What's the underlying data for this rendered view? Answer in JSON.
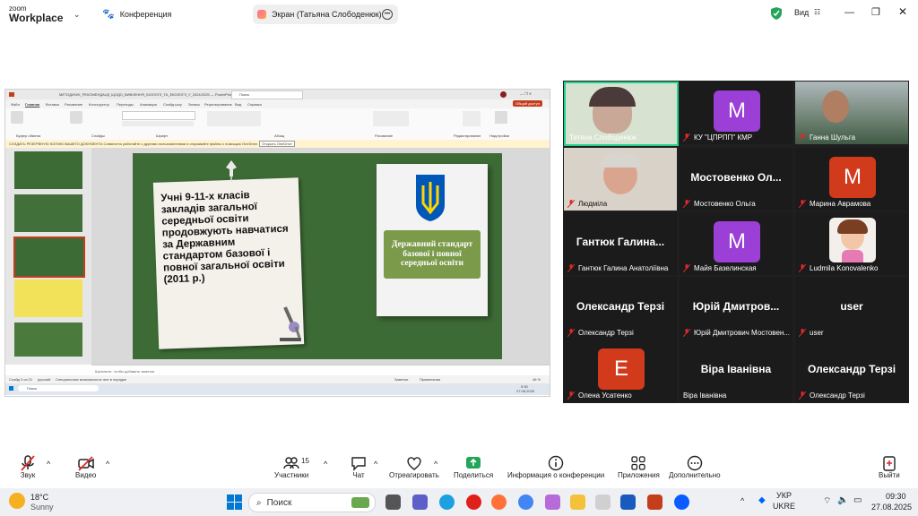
{
  "zoom": {
    "logo_line1": "zoom",
    "logo_line2": "Workplace",
    "conference_label": "Конференция",
    "screen_share_label": "Экран (Татьяна Слободенюк)",
    "view_label": "Вид"
  },
  "ppt": {
    "title": "МЕТОДИЧНІ_РЕКОМЕНДАЦІЇ_ЩОДО_ВИВЧЕННЯ_БІОЛОГІЇ_ТА_ЕКОЛОГІЇ_У_2024/2025 — PowerPoint",
    "search": "Поиск",
    "menu": [
      "Файл",
      "Главная",
      "Вставка",
      "Рисование",
      "Конструктор",
      "Переходы",
      "Анимация",
      "Слайд-шоу",
      "Запись",
      "Рецензирование",
      "Вид",
      "Справка"
    ],
    "share_button": "Общий доступ",
    "ribbon_groups": [
      "Буфер обмена",
      "Слайды",
      "Шрифт",
      "Абзац",
      "Рисование",
      "Редактирование",
      "Надстройки"
    ],
    "notif": "СОЗДАТЬ РЕЗЕРВНУЮ КОПИЮ ВАШЕГО ДОКУМЕНТА   Совместно работайте с другими пользователями и открывайте файлы с помощью OneDrive.",
    "notif_button": "Открыть OneDrive",
    "notes_placeholder": "Щелкните, чтобы добавить заметки",
    "status_left": "Слайд 3 из 21",
    "status_lang": "русский",
    "status_a11y": "Специальные возможности: все в порядке",
    "status_notes": "Заметки",
    "status_comments": "Примечания",
    "status_zoom": "46 %",
    "taskbar_search": "Поиск",
    "clock_time": "9:30",
    "clock_date": "27.08.2025"
  },
  "slide": {
    "text": "Учні 9-11-х класів закладів загальної середньої освіти продовжують навчатися за Державним стандартом базової і повної загальної освіти (2011 р.)",
    "book_title": "Державний стандарт базової і повної середньої освіти"
  },
  "participants": [
    {
      "name": "Тетяна Слободенюк",
      "type": "video",
      "active": true
    },
    {
      "name": "КУ \"ЦПРПП\" КМР",
      "type": "avatar",
      "letter": "M",
      "color": "#9b3fd6"
    },
    {
      "name": "Ганна Шульга",
      "type": "video"
    },
    {
      "name": "Людміла",
      "type": "video"
    },
    {
      "name": "Мостовенко Ольга",
      "type": "text",
      "display": "Мостовенко Ол..."
    },
    {
      "name": "Марина Аврамова",
      "type": "avatar",
      "letter": "M",
      "color": "#d23a1c"
    },
    {
      "name": "Гантюк Галина Анатоліївна",
      "type": "text",
      "display": "Гантюк Галина..."
    },
    {
      "name": "Майя Базелинская",
      "type": "avatar",
      "letter": "M",
      "color": "#9b3fd6"
    },
    {
      "name": "Ludmila Konovalenko",
      "type": "cartoon"
    },
    {
      "name": "Олександр Терзі",
      "type": "text",
      "display": "Олександр Терзі"
    },
    {
      "name": "Юрій Дмитрович Мостовен...",
      "type": "text",
      "display": "Юрій Дмитров..."
    },
    {
      "name": "user",
      "type": "text",
      "display": "user"
    },
    {
      "name": "Олена Усатенко",
      "type": "avatar",
      "letter": "E",
      "color": "#d23a1c"
    },
    {
      "name": "Віра Іванівна",
      "type": "text",
      "display": "Віра Іванівна"
    },
    {
      "name": "Олександр Терзі",
      "type": "text",
      "display": "Олександр Терзі"
    }
  ],
  "toolbar": {
    "audio": "Звук",
    "video": "Видео",
    "participants": "Участники",
    "participants_count": "15",
    "chat": "Чат",
    "react": "Отреагировать",
    "share": "Поделиться",
    "info": "Информация о конференции",
    "apps": "Приложения",
    "more": "Дополнительно",
    "leave": "Выйти"
  },
  "taskbar": {
    "weather_temp": "18°C",
    "weather_desc": "Sunny",
    "search": "Поиск",
    "lang1": "УКР",
    "lang2": "UKRE",
    "time": "09:30",
    "date": "27.08.2025"
  },
  "colors": {
    "zoom_blue": "#0b5cff",
    "active_border": "#23d18b",
    "muted_red": "#e02828",
    "slide_green": "#3d6b35",
    "book_green": "#7b9a4a"
  }
}
